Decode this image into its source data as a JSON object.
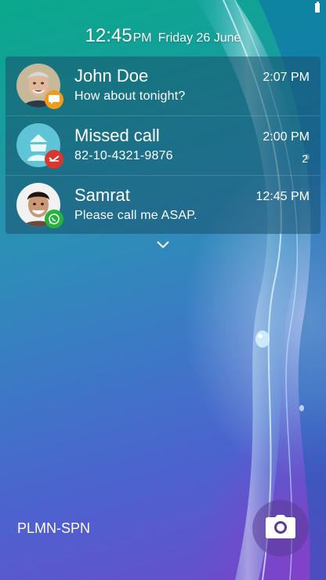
{
  "status_bar": {
    "battery_icon": "battery-icon"
  },
  "lockscreen": {
    "time": "12:45",
    "ampm": "PM",
    "date": "Friday 26 June"
  },
  "notifications": [
    {
      "title": "John Doe",
      "subtitle": "How about tonight?",
      "time": "2:07 PM",
      "count": "",
      "avatar_icon": "contact-photo-john-doe",
      "badge_icon": "message-icon",
      "badge_color": "#f29a1a"
    },
    {
      "title": "Missed call",
      "subtitle": "82-10-4321-9876",
      "time": "2:00 PM",
      "count": "2",
      "avatar_icon": "default-contact-icon",
      "badge_icon": "missed-call-icon",
      "badge_color": "#d8372f"
    },
    {
      "title": "Samrat",
      "subtitle": "Please call me ASAP.",
      "time": "12:45 PM",
      "count": "",
      "avatar_icon": "contact-photo-samrat",
      "badge_icon": "whatsapp-icon",
      "badge_color": "#25b33c"
    }
  ],
  "expand_icon": "chevron-down-icon",
  "carrier": "PLMN-SPN",
  "camera_shortcut_icon": "camera-icon"
}
